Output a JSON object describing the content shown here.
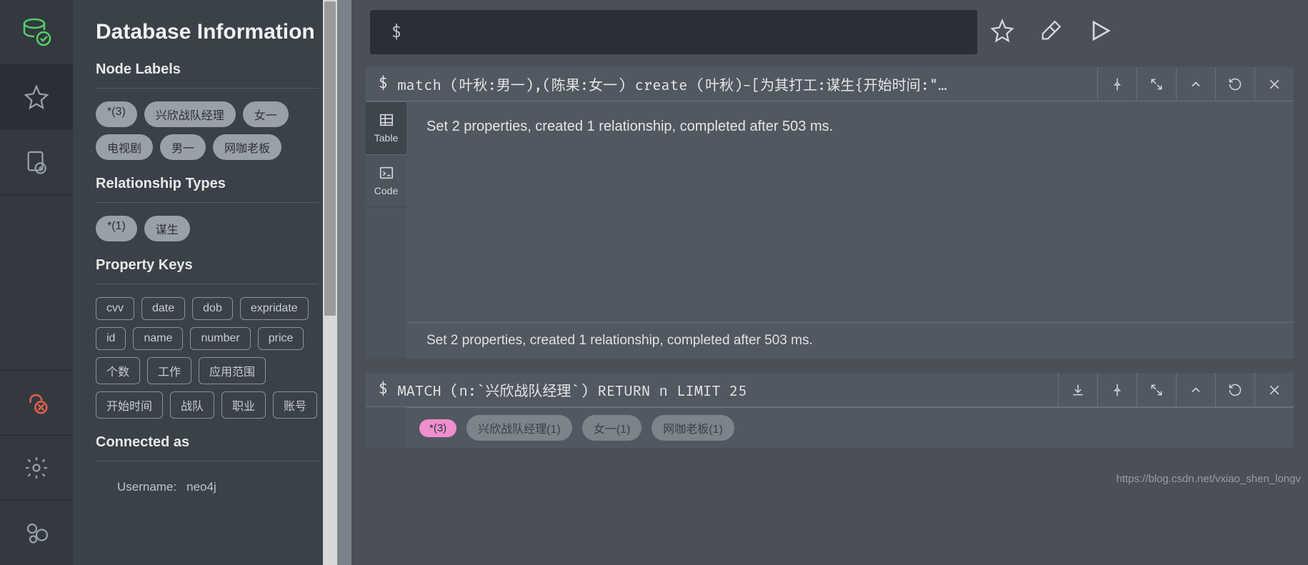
{
  "sidebar": {
    "title": "Database Information",
    "nodeLabels": {
      "title": "Node Labels",
      "items": [
        "*(3)",
        "兴欣战队经理",
        "女一",
        "电视剧",
        "男一",
        "网咖老板"
      ]
    },
    "relTypes": {
      "title": "Relationship Types",
      "items": [
        "*(1)",
        "谋生"
      ]
    },
    "propKeys": {
      "title": "Property Keys",
      "items": [
        "cvv",
        "date",
        "dob",
        "expridate",
        "id",
        "name",
        "number",
        "price",
        "个数",
        "工作",
        "应用范围",
        "开始时间",
        "战队",
        "职业",
        "账号"
      ]
    },
    "connected": {
      "title": "Connected as",
      "usernameLabel": "Username:",
      "usernameValue": "neo4j"
    }
  },
  "editor": {
    "prompt": "$"
  },
  "frame1": {
    "prompt": "$",
    "query": "match (叶秋:男一),(陈果:女一) create (叶秋)-[为其打工:谋生{开始时间:\"…",
    "tabs": {
      "table": "Table",
      "code": "Code"
    },
    "result": "Set 2 properties, created 1 relationship, completed after 503 ms.",
    "footer": "Set 2 properties, created 1 relationship, completed after 503 ms."
  },
  "frame2": {
    "prompt": "$",
    "query": "MATCH (n:`兴欣战队经理`) RETURN n LIMIT 25",
    "chips": [
      "*(3)",
      "兴欣战队经理(1)",
      "女一(1)",
      "网咖老板(1)"
    ]
  },
  "watermark": "https://blog.csdn.net/vxiao_shen_longv"
}
